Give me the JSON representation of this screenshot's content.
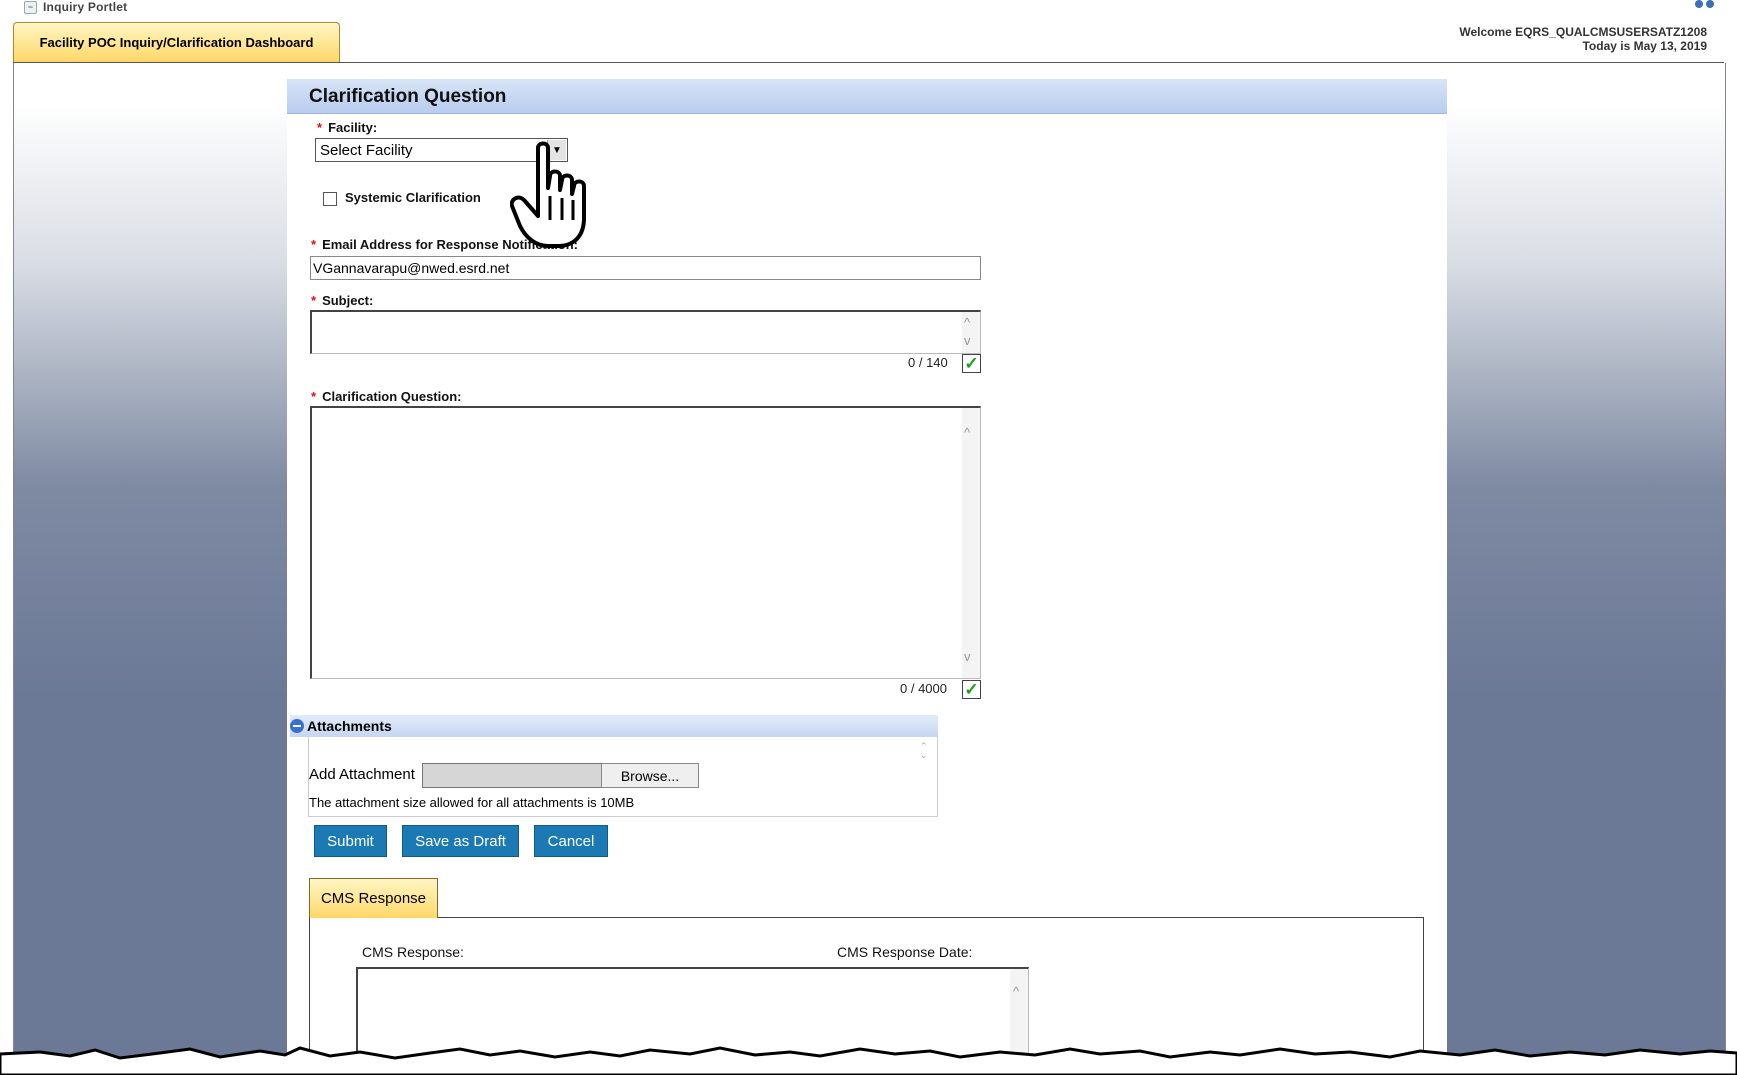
{
  "portlet": {
    "title": "Inquiry Portlet",
    "tab_label": "Facility POC Inquiry/Clarification Dashboard",
    "welcome_line": "Welcome EQRS_QUALCMSUSERSATZ1208",
    "date_line": "Today is May 13, 2019"
  },
  "form": {
    "section_title": "Clarification Question",
    "facility_label": "Facility:",
    "facility_value": "Select Facility",
    "systemic_label": "Systemic Clarification",
    "email_label": "Email Address for Response Notification:",
    "email_value": "VGannavarapu@nwed.esrd.net",
    "subject_label": "Subject:",
    "subject_counter": "0 / 140",
    "question_label": "Clarification Question:",
    "question_counter": "0 / 4000"
  },
  "attachments": {
    "title": "Attachments",
    "add_label": "Add Attachment",
    "browse_label": "Browse...",
    "note": "The attachment size allowed for all attachments is 10MB"
  },
  "buttons": {
    "submit": "Submit",
    "save_draft": "Save as Draft",
    "cancel": "Cancel"
  },
  "cms": {
    "tab_label": "CMS Response",
    "response_label": "CMS Response:",
    "date_label": "CMS Response Date:"
  },
  "icons": {
    "cursor": "hand-pointer-icon",
    "valid": "check-mark-icon",
    "collapse": "minus-circle-icon"
  },
  "colors": {
    "tab_gold": "#ffd768",
    "section_blue": "#c6d6f1",
    "button_blue": "#1b79b3",
    "required_red": "#d11111",
    "check_green": "#1ca01c"
  }
}
